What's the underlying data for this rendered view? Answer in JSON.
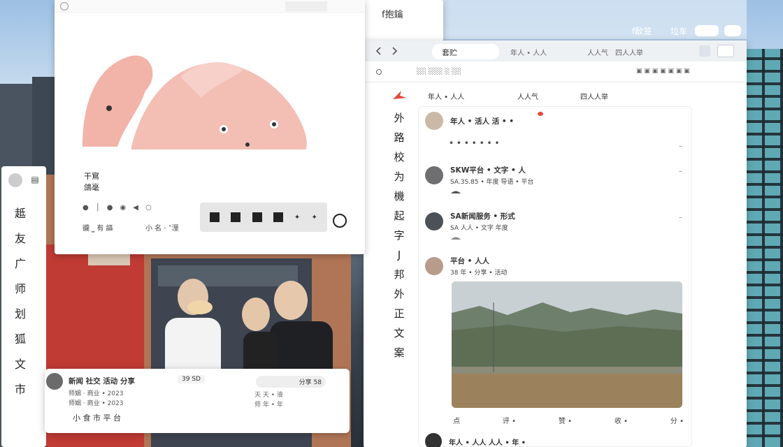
{
  "desktop": {
    "topbar_title": "f抱鑰",
    "topbar_right": [
      "f歃笼",
      "垃车"
    ],
    "icons": [
      "window-icon",
      "window-icon"
    ]
  },
  "art_window": {
    "label_title": "干窵",
    "label_sub": "鴿毫",
    "tool_chips": [
      "✦",
      "✦",
      "✦",
      "✦"
    ],
    "tool_row_a": "豅 ⎵ 有 謳",
    "tool_row_b": "小 名 · ˂溼"
  },
  "left_panel": {
    "nav": [
      "趆",
      "友",
      "广",
      "师",
      "划",
      "狐",
      "文",
      "市"
    ]
  },
  "photo_card": {
    "title": "新闻 社交 活动 分享",
    "badge": "39 SD",
    "meta": "师姻 · 商业 • 2023",
    "caption": "小 食 市 平 台",
    "right_pill": "分享 58",
    "right_line1": "天 天 • 液",
    "right_line2": "师 年 • 年"
  },
  "browser": {
    "tab_title": "套贮",
    "nav_items": [
      "年人 • 人人",
      "人人气",
      "四人人举"
    ],
    "side_nav": [
      "外",
      "路",
      "校",
      "为",
      "機",
      "起",
      "字",
      "J",
      "邦",
      "外",
      "正",
      "文",
      "案"
    ]
  },
  "feed": {
    "posts": [
      {
        "name": "年人 • 活人  活 • •",
        "text": "• • • • • • •",
        "ts": "–"
      },
      {
        "name": "SKW平台 • 文字 • 人",
        "text": "SA.3S.85 • 年度 导语 • 平台",
        "ts": "–"
      },
      {
        "name": "SA新闻服务 • 形式",
        "text": "SA 人人 • 文字 年度",
        "ts": "–"
      },
      {
        "name": "平台 • 人人",
        "text": "38 年 • 分享 • 活动",
        "ts": ""
      }
    ],
    "photo_footer": [
      "点",
      "评 •",
      "赞 •",
      "收 •",
      "分 •"
    ],
    "last_post": "年人 • 人人 人人 • 年 •"
  },
  "colors": {
    "accent": "#e24a3b",
    "ink": "#333333",
    "panel": "#ffffff",
    "sky": "#b5d1ea"
  }
}
